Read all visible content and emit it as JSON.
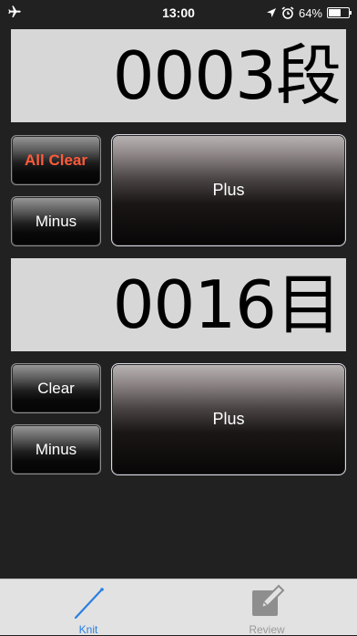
{
  "status_bar": {
    "time": "13:00",
    "battery_percent": "64%",
    "battery_level": 0.64,
    "icons": [
      "airplane-icon",
      "location-arrow-icon",
      "alarm-clock-icon",
      "battery-icon"
    ]
  },
  "rows_counter": {
    "display": "0003段"
  },
  "rows_controls": {
    "all_clear_label": "All Clear",
    "minus_label": "Minus",
    "plus_label": "Plus"
  },
  "stitches_counter": {
    "display": "0016目"
  },
  "stitches_controls": {
    "clear_label": "Clear",
    "minus_label": "Minus",
    "plus_label": "Plus"
  },
  "tab_bar": {
    "tabs": [
      {
        "label": "Knit",
        "icon": "knitting-needle-icon",
        "active": true
      },
      {
        "label": "Review",
        "icon": "edit-note-icon",
        "active": false
      }
    ]
  },
  "colors": {
    "background": "#212121",
    "display_bg": "#d7d7d7",
    "all_clear_text": "#ff5a3a",
    "tab_active": "#2a7fe0",
    "tab_inactive": "#9a9a9a"
  }
}
